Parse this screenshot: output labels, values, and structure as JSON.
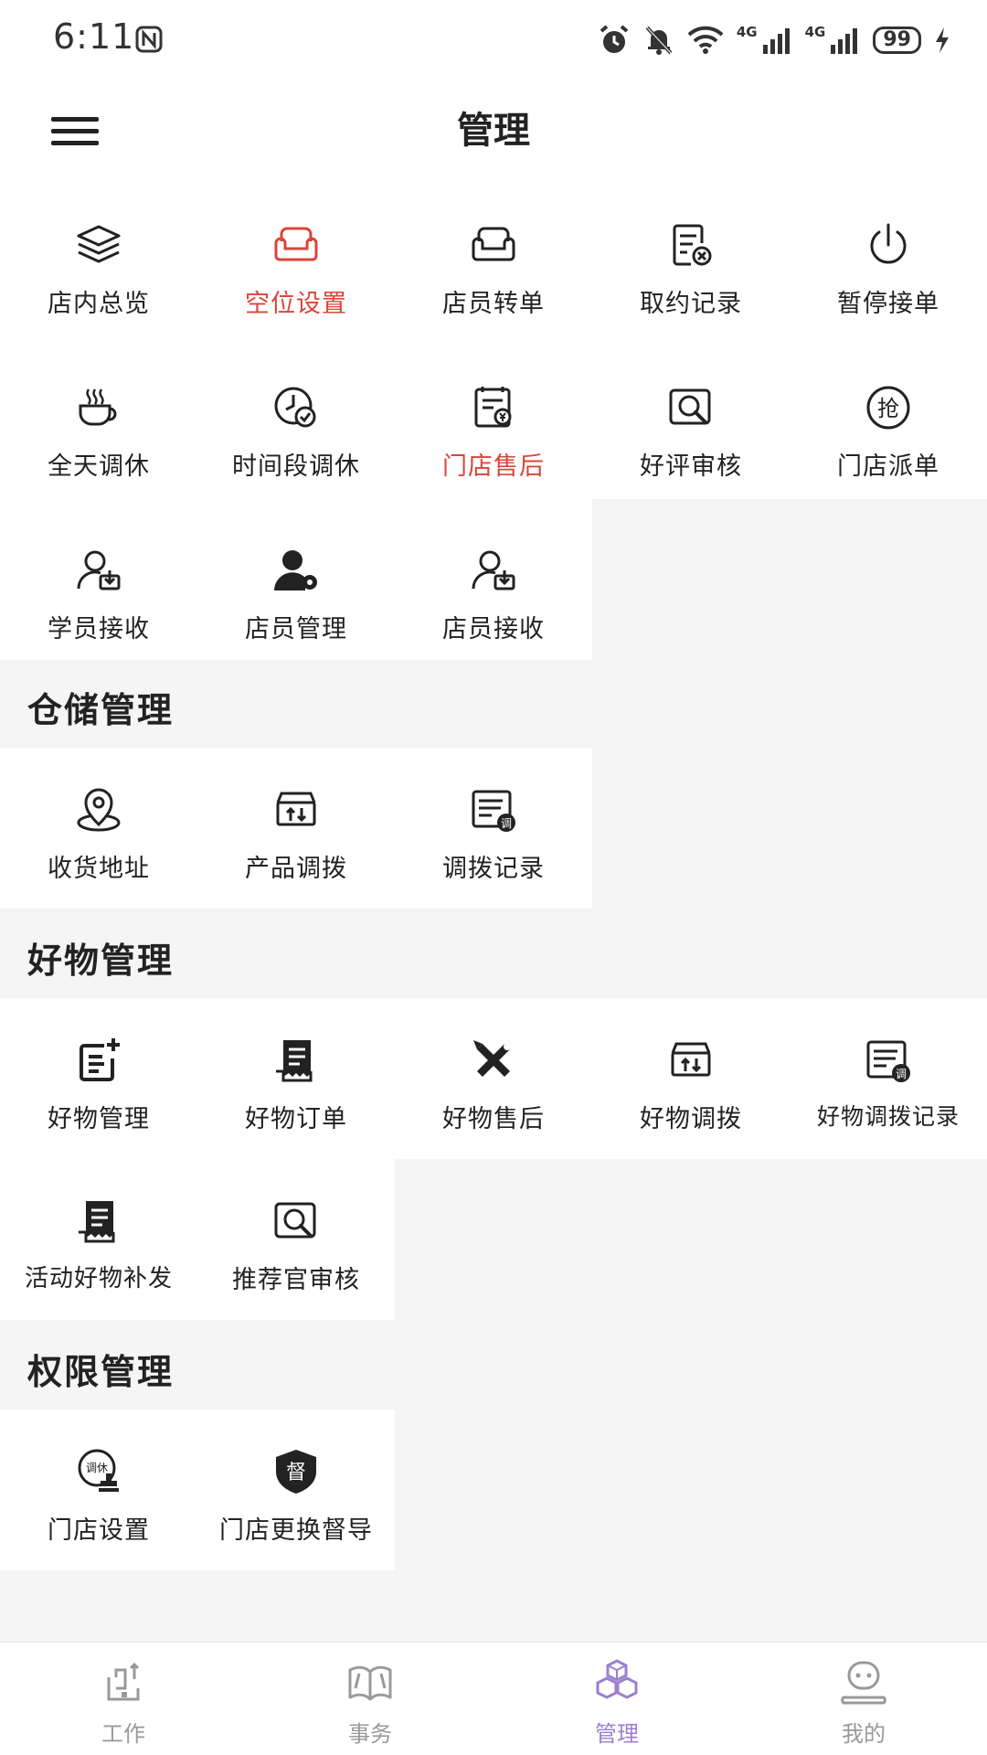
{
  "status_bar": {
    "time": "6:11",
    "battery": "99",
    "net1": "4G",
    "net2": "4G"
  },
  "header": {
    "title": "管理"
  },
  "colors": {
    "accent_red": "#d9453a",
    "accent_purple": "#9b7fd0"
  },
  "store_section": {
    "items": [
      {
        "label": "店内总览",
        "icon": "layers-icon"
      },
      {
        "label": "空位设置",
        "icon": "sofa-icon",
        "highlight": true
      },
      {
        "label": "店员转单",
        "icon": "armchair-icon"
      },
      {
        "label": "取约记录",
        "icon": "cancel-record-icon"
      },
      {
        "label": "暂停接单",
        "icon": "power-icon"
      },
      {
        "label": "全天调休",
        "icon": "coffee-cup-icon"
      },
      {
        "label": "时间段调休",
        "icon": "clock-check-icon"
      },
      {
        "label": "门店售后",
        "icon": "receipt-icon",
        "highlight": true
      },
      {
        "label": "好评审核",
        "icon": "review-search-icon"
      },
      {
        "label": "门店派单",
        "icon": "grab-order-icon"
      },
      {
        "label": "学员接收",
        "icon": "user-receive-icon"
      },
      {
        "label": "店员管理",
        "icon": "user-gear-icon"
      },
      {
        "label": "店员接收",
        "icon": "user-receive-icon"
      }
    ]
  },
  "warehouse_section": {
    "title": "仓储管理",
    "items": [
      {
        "label": "收货地址",
        "icon": "location-pin-icon"
      },
      {
        "label": "产品调拨",
        "icon": "transfer-box-icon"
      },
      {
        "label": "调拨记录",
        "icon": "transfer-record-icon"
      }
    ]
  },
  "goods_section": {
    "title": "好物管理",
    "items": [
      {
        "label": "好物管理",
        "icon": "add-doc-icon"
      },
      {
        "label": "好物订单",
        "icon": "order-receipt-icon"
      },
      {
        "label": "好物售后",
        "icon": "tools-icon"
      },
      {
        "label": "好物调拨",
        "icon": "transfer-box-icon"
      },
      {
        "label": "好物调拨记录",
        "icon": "transfer-record-icon"
      },
      {
        "label": "活动好物补发",
        "icon": "order-receipt-icon"
      },
      {
        "label": "推荐官审核",
        "icon": "review-search-icon"
      }
    ]
  },
  "permission_section": {
    "title": "权限管理",
    "items": [
      {
        "label": "门店设置",
        "icon": "stamp-icon",
        "badge": "调休"
      },
      {
        "label": "门店更换督导",
        "icon": "shield-icon",
        "badge": "督"
      }
    ]
  },
  "grab_badge": "抢",
  "record_badge": "调",
  "bottom_nav": {
    "items": [
      {
        "label": "工作",
        "icon": "work-icon"
      },
      {
        "label": "事务",
        "icon": "book-icon"
      },
      {
        "label": "管理",
        "icon": "cubes-icon",
        "active": true
      },
      {
        "label": "我的",
        "icon": "profile-icon"
      }
    ]
  }
}
